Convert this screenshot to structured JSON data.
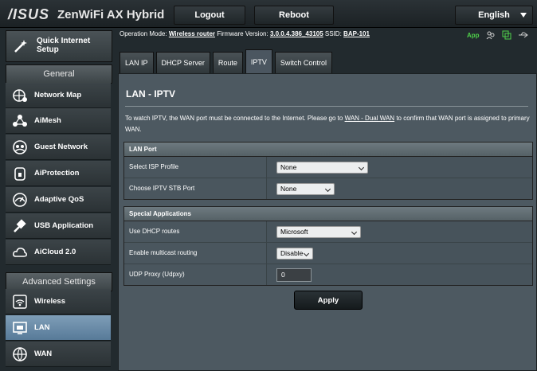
{
  "header": {
    "logo": "/ISUS",
    "model": "ZenWiFi AX Hybrid",
    "logout_label": "Logout",
    "reboot_label": "Reboot",
    "language": "English"
  },
  "sidebar": {
    "quick_setup_line1": "Quick Internet",
    "quick_setup_line2": "Setup",
    "general_heading": "General",
    "general_items": [
      {
        "label": "Network Map",
        "icon": "globe-network-icon"
      },
      {
        "label": "AiMesh",
        "icon": "mesh-icon"
      },
      {
        "label": "Guest Network",
        "icon": "guest-network-icon"
      },
      {
        "label": "AiProtection",
        "icon": "lock-shield-icon"
      },
      {
        "label": "Adaptive QoS",
        "icon": "gauge-icon"
      },
      {
        "label": "USB Application",
        "icon": "usb-icon"
      },
      {
        "label": "AiCloud 2.0",
        "icon": "cloud-icon"
      }
    ],
    "advanced_heading": "Advanced Settings",
    "advanced_items": [
      {
        "label": "Wireless",
        "icon": "wifi-icon"
      },
      {
        "label": "LAN",
        "icon": "lan-icon",
        "active": true
      },
      {
        "label": "WAN",
        "icon": "globe-icon"
      }
    ]
  },
  "status_bar": {
    "op_mode_label": "Operation Mode:",
    "op_mode_value": "Wireless router",
    "firmware_label": "Firmware Version:",
    "firmware_value": "3.0.0.4.386_43105",
    "ssid_label": "SSID:",
    "ssid_value": "BAP-101",
    "app_label": "App"
  },
  "tabs": [
    "LAN IP",
    "DHCP Server",
    "Route",
    "IPTV",
    "Switch Control"
  ],
  "selected_tab": "IPTV",
  "panel": {
    "title": "LAN - IPTV",
    "desc_part1": "To watch IPTV, the WAN port must be connected to the Internet. Please go to ",
    "desc_link": "WAN - Dual WAN",
    "desc_part2": " to confirm that WAN port is assigned to primary WAN.",
    "lan_port_heading": "LAN Port",
    "isp_profile_label": "Select ISP Profile",
    "isp_profile_value": "None",
    "stb_port_label": "Choose IPTV STB Port",
    "stb_port_value": "None",
    "special_heading": "Special Applications",
    "dhcp_routes_label": "Use DHCP routes",
    "dhcp_routes_value": "Microsoft",
    "multicast_label": "Enable multicast routing",
    "multicast_value": "Disable",
    "udpxy_label": "UDP Proxy (Udpxy)",
    "udpxy_value": "0",
    "apply_label": "Apply"
  },
  "colors": {
    "background": "#222a2e",
    "panel": "#4d5961",
    "active_nav": "#6f90ac",
    "app_green": "#4fd04a"
  }
}
